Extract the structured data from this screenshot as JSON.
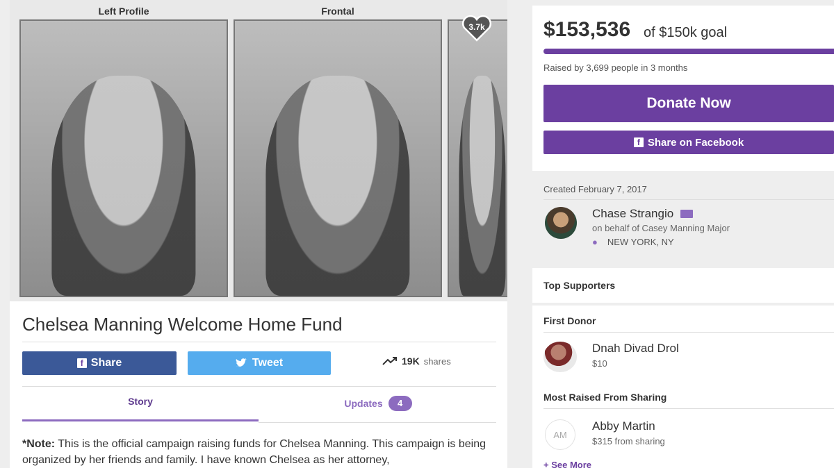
{
  "photo": {
    "left_label": "Left Profile",
    "center_label": "Frontal",
    "heart_count": "3.7k"
  },
  "campaign": {
    "title": "Chelsea Manning Welcome Home Fund",
    "share_label": "Share",
    "tweet_label": "Tweet",
    "shares_count": "19K",
    "shares_unit": "shares"
  },
  "tabs": {
    "story": "Story",
    "updates": "Updates",
    "updates_count": "4"
  },
  "story": {
    "note_label": "*Note:",
    "text": " This is the official campaign raising funds for Chelsea Manning. This campaign is being organized by her friends and family. I have known Chelsea as her attorney,"
  },
  "sidebar": {
    "amount": "$153,536",
    "goal": "of $150k goal",
    "progress_fraction": 1.0,
    "raised_text": "Raised by 3,699 people in 3 months",
    "donate_label": "Donate Now",
    "facebook_label": "Share on Facebook",
    "created": "Created February 7, 2017",
    "organizer_name": "Chase Strangio",
    "on_behalf": "on behalf of Casey Manning Major",
    "location": "NEW YORK, NY",
    "top_supporters": "Top Supporters",
    "first_donor_heading": "First Donor",
    "first_donor_name": "Dnah Divad Drol",
    "first_donor_amount": "$10",
    "most_raised_heading": "Most Raised From Sharing",
    "sharer_initials": "AM",
    "sharer_name": "Abby Martin",
    "sharer_amount": "$315 from sharing",
    "see_more": "See More"
  },
  "colors": {
    "accent": "#6b3fa0",
    "facebook": "#3b5998",
    "twitter": "#55acee"
  },
  "icons": [
    "heart-icon",
    "facebook-icon",
    "twitter-icon",
    "trending-icon",
    "mail-icon",
    "map-pin-icon",
    "plus-icon"
  ]
}
